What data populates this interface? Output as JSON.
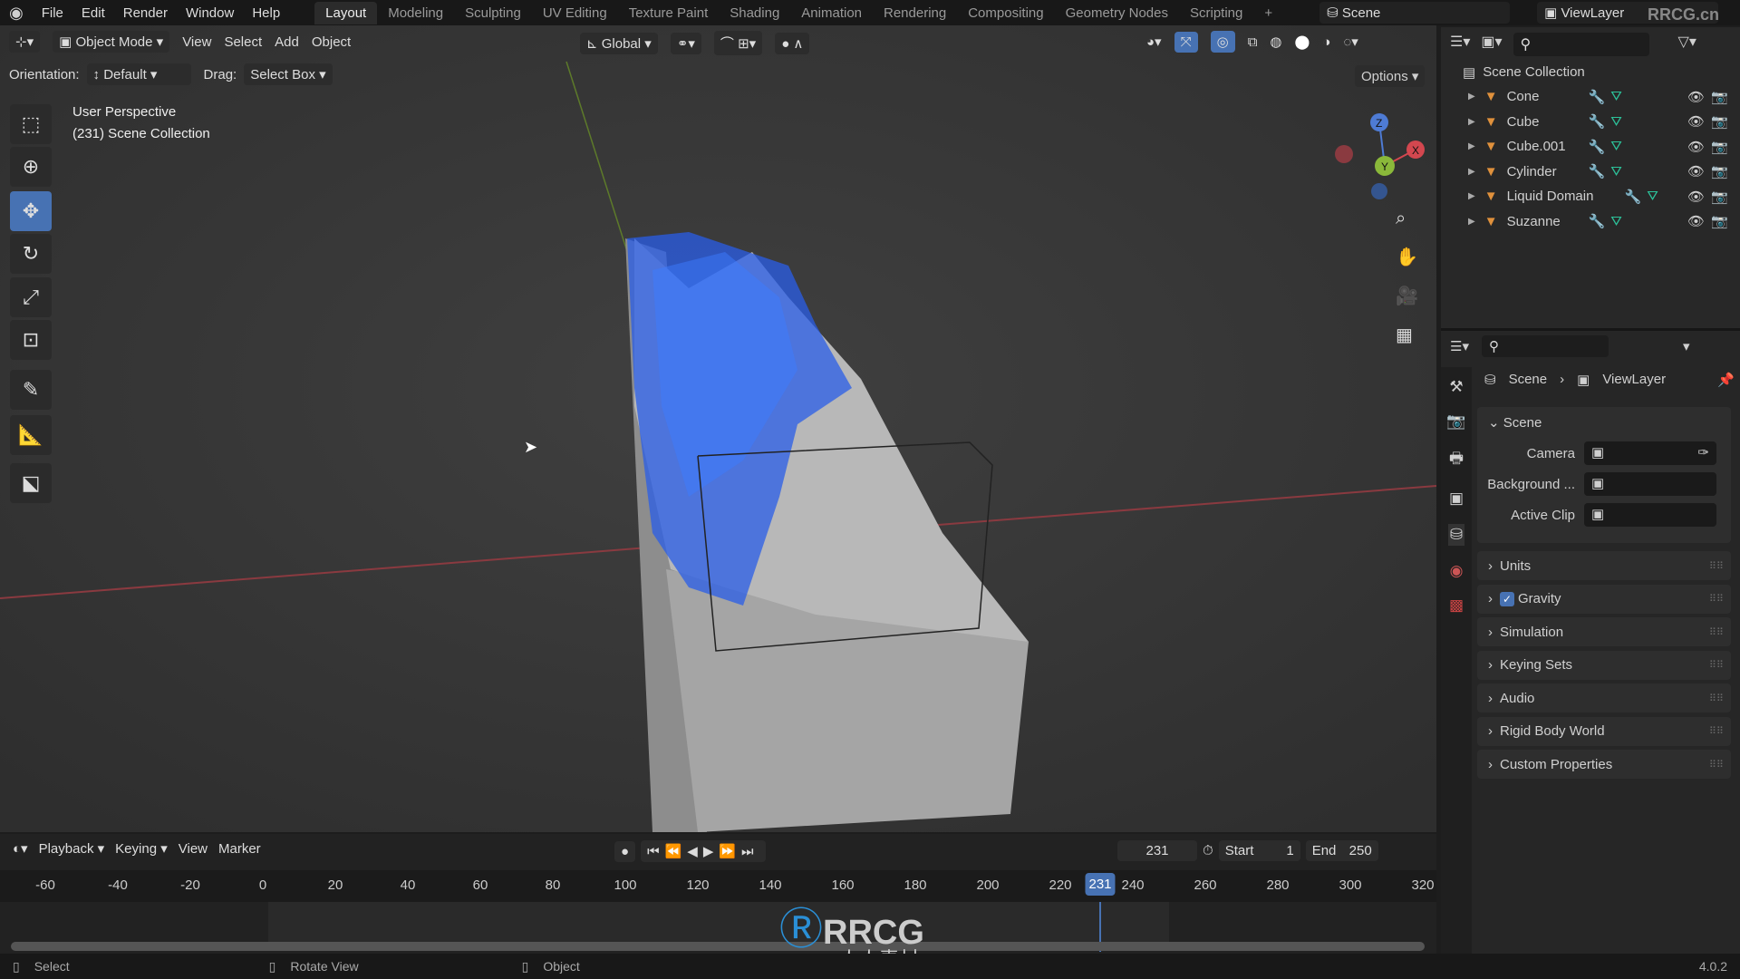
{
  "topbar": {
    "menus": [
      "File",
      "Edit",
      "Render",
      "Window",
      "Help"
    ],
    "workspaces": [
      "Layout",
      "Modeling",
      "Sculpting",
      "UV Editing",
      "Texture Paint",
      "Shading",
      "Animation",
      "Rendering",
      "Compositing",
      "Geometry Nodes",
      "Scripting"
    ],
    "active_workspace": "Layout",
    "add": "+",
    "scene": "Scene",
    "view_layer": "ViewLayer"
  },
  "viewport": {
    "mode": "Object Mode",
    "menus": [
      "View",
      "Select",
      "Add",
      "Object"
    ],
    "transform_orientation": "Global",
    "orientation_label": "Orientation:",
    "orientation_value": "Default",
    "drag_label": "Drag:",
    "drag_value": "Select Box",
    "options": "Options",
    "overlay_title": "User Perspective",
    "overlay_subtitle": "(231) Scene Collection",
    "tools": [
      "select-box-icon",
      "cursor-icon",
      "move-icon",
      "rotate-icon",
      "scale-icon",
      "transform-icon",
      "annotate-icon",
      "measure-icon",
      "add-cube-icon"
    ],
    "gizmo": {
      "x": "X",
      "y": "Y",
      "z": "Z"
    },
    "colors": {
      "x_axis": "#c2434c",
      "y_axis": "#6f9a2c",
      "fluid": "#2a5ee8",
      "domain": "#a9a9a9",
      "active": "#4772b3"
    }
  },
  "outliner": {
    "root": "Scene Collection",
    "items": [
      {
        "name": "Cone"
      },
      {
        "name": "Cube"
      },
      {
        "name": "Cube.001"
      },
      {
        "name": "Cylinder"
      },
      {
        "name": "Liquid Domain"
      },
      {
        "name": "Suzanne"
      }
    ]
  },
  "properties": {
    "breadcrumb": [
      "Scene",
      "ViewLayer"
    ],
    "panel_scene": "Scene",
    "fields": [
      {
        "label": "Camera"
      },
      {
        "label": "Background ..."
      },
      {
        "label": "Active Clip"
      }
    ],
    "panels": [
      "Units",
      "Gravity",
      "Simulation",
      "Keying Sets",
      "Audio",
      "Rigid Body World",
      "Custom Properties"
    ],
    "gravity_checked": true
  },
  "timeline": {
    "menus": [
      "Playback",
      "Keying",
      "View",
      "Marker"
    ],
    "current_frame": "231",
    "start_label": "Start",
    "start": "1",
    "end_label": "End",
    "end": "250",
    "ticks": [
      "-60",
      "-40",
      "-20",
      "0",
      "20",
      "40",
      "60",
      "80",
      "100",
      "120",
      "140",
      "160",
      "180",
      "200",
      "220",
      "240",
      "260",
      "280",
      "300",
      "320"
    ]
  },
  "status": {
    "items": [
      "Select",
      "Rotate View",
      "Object"
    ],
    "version": "4.0.2"
  },
  "watermark": {
    "text": "RRCG",
    "sub": "人人素材",
    "corner": "RRCG.cn"
  }
}
